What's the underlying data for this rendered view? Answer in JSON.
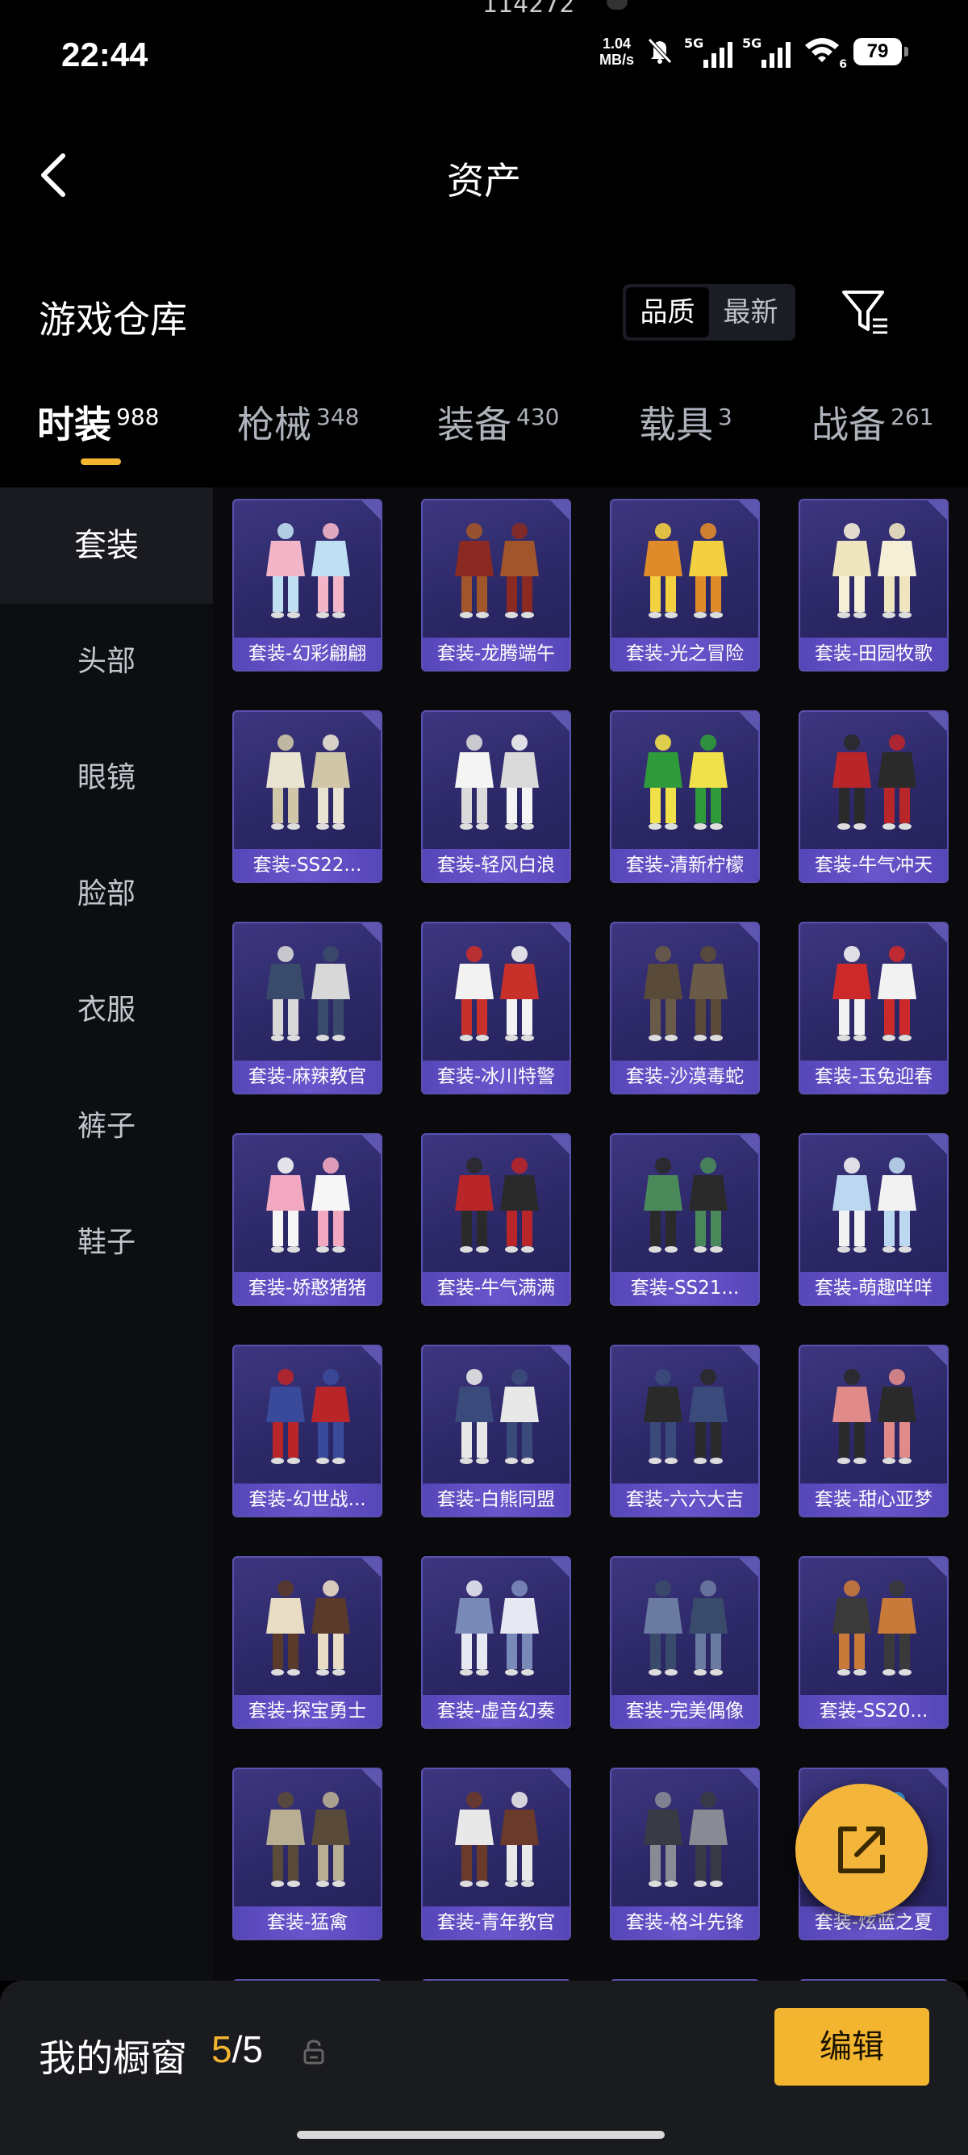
{
  "status_bar": {
    "time": "22:44",
    "top_fragment": "114272",
    "net_speed_value": "1.04",
    "net_speed_unit": "MB/s",
    "signal1_label": "5G",
    "signal2_label": "5G",
    "wifi_label": "6",
    "battery": "79"
  },
  "header": {
    "title": "资产"
  },
  "section": {
    "title": "游戏仓库",
    "sort_options": [
      "品质",
      "最新"
    ],
    "sort_active": "品质"
  },
  "tabs": [
    {
      "label": "时装",
      "count": "988"
    },
    {
      "label": "枪械",
      "count": "348"
    },
    {
      "label": "装备",
      "count": "430"
    },
    {
      "label": "载具",
      "count": "3"
    },
    {
      "label": "战备",
      "count": "261"
    }
  ],
  "sidebar": {
    "items": [
      "套装",
      "头部",
      "眼镜",
      "脸部",
      "衣服",
      "裤子",
      "鞋子"
    ],
    "active": "套装"
  },
  "grid": {
    "items": [
      "套装-幻彩翩翩",
      "套装-龙腾端午",
      "套装-光之冒险",
      "套装-田园牧歌",
      "套装-SS22...",
      "套装-轻风白浪",
      "套装-清新柠檬",
      "套装-牛气冲天",
      "套装-麻辣教官",
      "套装-冰川特警",
      "套装-沙漠毒蛇",
      "套装-玉兔迎春",
      "套装-娇憨猪猪",
      "套装-牛气满满",
      "套装-SS21...",
      "套装-萌趣咩咩",
      "套装-幻世战...",
      "套装-白熊同盟",
      "套装-六六大吉",
      "套装-甜心亚梦",
      "套装-探宝勇士",
      "套装-虚音幻奏",
      "套装-完美偶像",
      "套装-SS20...",
      "套装-猛禽",
      "套装-青年教官",
      "套装-格斗先锋",
      "套装-炫蓝之夏"
    ],
    "outfit_colors": [
      [
        "#f2b6c8",
        "#bfe0f2"
      ],
      [
        "#8a2a22",
        "#a0552a"
      ],
      [
        "#e08b2a",
        "#f2d040"
      ],
      [
        "#efe6c0",
        "#f6efd8"
      ],
      [
        "#e9e4d2",
        "#cfc7a8"
      ],
      [
        "#f4f4f4",
        "#dadada"
      ],
      [
        "#2f9a3a",
        "#f0e04a"
      ],
      [
        "#b8262a",
        "#2a2a2a"
      ],
      [
        "#3a4a6a",
        "#d8d8d8"
      ],
      [
        "#f2f2f2",
        "#c8302a"
      ],
      [
        "#5a4a3a",
        "#6a5a48"
      ],
      [
        "#cc2a2a",
        "#f2f2f2"
      ],
      [
        "#f2a8c0",
        "#f6f6f6"
      ],
      [
        "#b8262a",
        "#2a2a2a"
      ],
      [
        "#4a8a5a",
        "#2a2a2a"
      ],
      [
        "#bcd8f0",
        "#f2f2f2"
      ],
      [
        "#3a4a9a",
        "#b8262a"
      ],
      [
        "#3a4a7a",
        "#e8e8e8"
      ],
      [
        "#2a2a2a",
        "#3a4a7a"
      ],
      [
        "#e08a8a",
        "#2a2a2a"
      ],
      [
        "#e8dcc4",
        "#5a3a2a"
      ],
      [
        "#7a8ab8",
        "#e8e8f2"
      ],
      [
        "#6a7aa0",
        "#3a4a6a"
      ],
      [
        "#3a3a3a",
        "#c87a3a"
      ],
      [
        "#b8ae94",
        "#5a4a3a"
      ],
      [
        "#e8e8e8",
        "#6a3a2a"
      ],
      [
        "#3a3a44",
        "#8a8a94"
      ],
      [
        "#3aa0e0",
        "#f2f2f2"
      ]
    ]
  },
  "bottom_bar": {
    "label": "我的橱窗",
    "count_used": "5",
    "count_sep": "/",
    "count_total": "5",
    "edit_label": "编辑"
  },
  "colors": {
    "accent": "#f3b530",
    "card": "#3e3680",
    "card_label": "#6a56cc"
  }
}
